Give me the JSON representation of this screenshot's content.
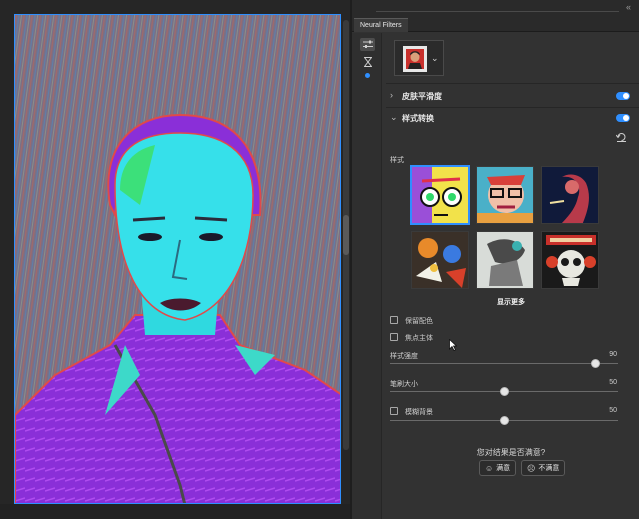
{
  "panel": {
    "tab_label": "Neural Filters",
    "tool_icons": [
      "sliders-icon",
      "hourglass-icon"
    ]
  },
  "filters": [
    {
      "label": "皮肤平滑度",
      "enabled": true,
      "expanded": false
    },
    {
      "label": "样式转换",
      "enabled": true,
      "expanded": true
    }
  ],
  "style_transfer": {
    "style_label": "样式",
    "show_more_label": "显示更多",
    "thumbnails": [
      {
        "name": "pop-art-face",
        "selected": true
      },
      {
        "name": "cubist-portrait",
        "selected": false
      },
      {
        "name": "night-smoker",
        "selected": false
      },
      {
        "name": "abstract-collage",
        "selected": false
      },
      {
        "name": "ink-sketch",
        "selected": false
      },
      {
        "name": "skull-tattoo",
        "selected": false
      }
    ],
    "checkboxes": [
      {
        "label": "保留配色",
        "checked": false
      },
      {
        "label": "焦点主体",
        "checked": false
      }
    ],
    "sliders": [
      {
        "label": "样式强度",
        "value": "90",
        "fraction": 0.9
      },
      {
        "label": "笔刷大小",
        "value": "50",
        "fraction": 0.5
      },
      {
        "label": "模糊背景",
        "value": "50",
        "fraction": 0.5,
        "has_checkbox": true
      }
    ]
  },
  "feedback": {
    "question": "您对结果是否满意?",
    "yes_label": "满意",
    "no_label": "不满意"
  },
  "colors": {
    "accent": "#2f8fff",
    "panel_bg": "#323232"
  }
}
